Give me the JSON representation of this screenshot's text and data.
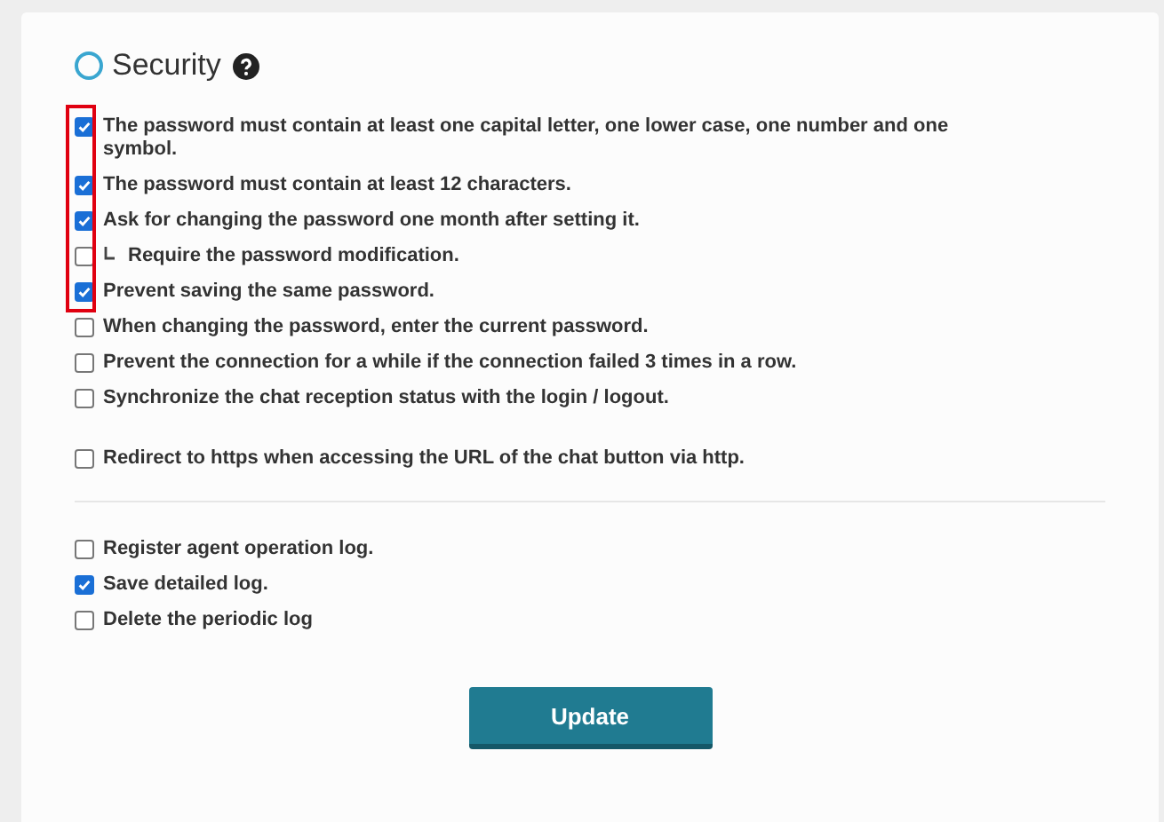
{
  "panel": {
    "title": "Security"
  },
  "groups": [
    {
      "kind": "highlighted",
      "options": [
        {
          "label": "The password must contain at least one capital letter, one lower case, one number and one symbol.",
          "checked": true
        },
        {
          "label": "The password must contain at least 12 characters.",
          "checked": true
        },
        {
          "label": "Ask for changing the password one month after setting it.",
          "checked": true,
          "children": [
            {
              "label": "Require the password modification.",
              "checked": false
            }
          ]
        },
        {
          "label": "Prevent saving the same password.",
          "checked": true
        }
      ]
    },
    {
      "kind": "plain",
      "options": [
        {
          "label": "When changing the password, enter the current password.",
          "checked": false
        },
        {
          "label": "Prevent the connection for a while if the connection failed 3 times in a row.",
          "checked": false
        },
        {
          "label": "Synchronize the chat reception status with the login / logout.",
          "checked": false
        }
      ]
    },
    {
      "kind": "gap"
    },
    {
      "kind": "plain",
      "options": [
        {
          "label": "Redirect to https when accessing the URL of the chat button via http.",
          "checked": false
        }
      ]
    },
    {
      "kind": "divider"
    },
    {
      "kind": "plain",
      "options": [
        {
          "label": "Register agent operation log.",
          "checked": false
        },
        {
          "label": "Save detailed log.",
          "checked": true
        },
        {
          "label": "Delete the periodic log",
          "checked": false
        }
      ]
    }
  ],
  "update_button": {
    "label": "Update"
  }
}
